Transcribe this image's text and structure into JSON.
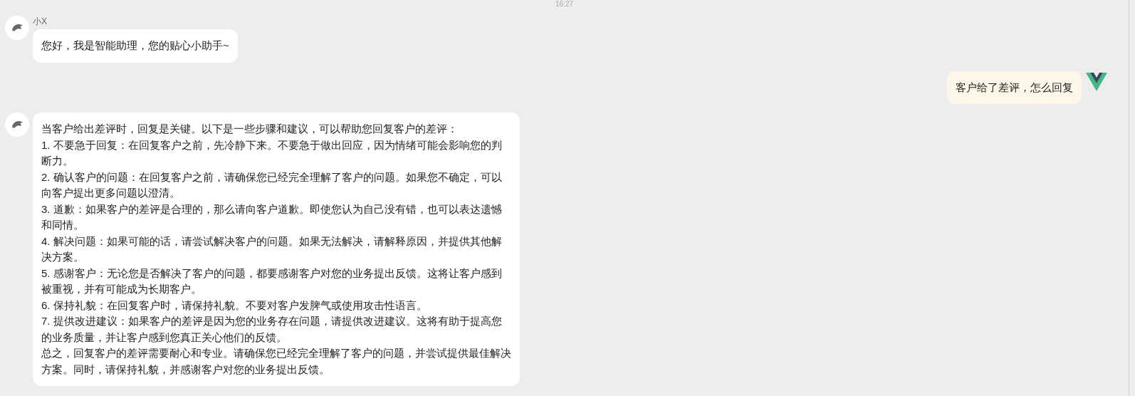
{
  "time": "16:27",
  "messages": [
    {
      "kind": "bot",
      "sender": "小X",
      "lines": [
        "您好，我是智能助理，您的贴心小助手~"
      ]
    },
    {
      "kind": "user",
      "lines": [
        "客户给了差评，怎么回复"
      ]
    },
    {
      "kind": "bot",
      "lines": [
        "当客户给出差评时，回复是关键。以下是一些步骤和建议，可以帮助您回复客户的差评：",
        "1. 不要急于回复：在回复客户之前，先冷静下来。不要急于做出回应，因为情绪可能会影响您的判断力。",
        "2. 确认客户的问题：在回复客户之前，请确保您已经完全理解了客户的问题。如果您不确定，可以向客户提出更多问题以澄清。",
        "3. 道歉：如果客户的差评是合理的，那么请向客户道歉。即使您认为自己没有错，也可以表达遗憾和同情。",
        "4. 解决问题：如果可能的话，请尝试解决客户的问题。如果无法解决，请解释原因，并提供其他解决方案。",
        "5. 感谢客户：无论您是否解决了客户的问题，都要感谢客户对您的业务提出反馈。这将让客户感到被重视，并有可能成为长期客户。",
        "6. 保持礼貌：在回复客户时，请保持礼貌。不要对客户发脾气或使用攻击性语言。",
        "7. 提供改进建议：如果客户的差评是因为您的业务存在问题，请提供改进建议。这将有助于提高您的业务质量，并让客户感到您真正关心他们的反馈。",
        "总之，回复客户的差评需要耐心和专业。请确保您已经完全理解了客户的问题，并尝试提供最佳解决方案。同时，请保持礼貌，并感谢客户对您的业务提出反馈。"
      ]
    }
  ]
}
